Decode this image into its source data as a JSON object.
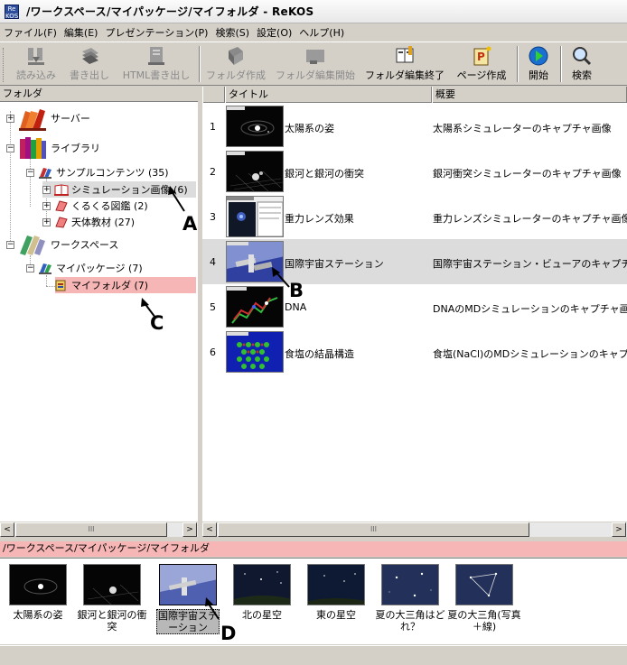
{
  "window": {
    "title": "/ワークスペース/マイパッケージ/マイフォルダ - ReKOS",
    "icon_text": "ReKOS"
  },
  "menu": [
    "ファイル(F)",
    "編集(E)",
    "プレゼンテーション(P)",
    "検索(S)",
    "設定(O)",
    "ヘルプ(H)"
  ],
  "toolbar": {
    "read": "読み込み",
    "export": "書き出し",
    "html_export": "HTML書き出し",
    "create_folder": "フォルダ作成",
    "start_folder_edit": "フォルダ編集開始",
    "end_folder_edit": "フォルダ編集終了",
    "create_page": "ページ作成",
    "start": "開始",
    "search": "検索"
  },
  "folder_panel": {
    "header": "フォルダ"
  },
  "tree": {
    "server": "サーバー",
    "library": "ライブラリ",
    "sample_contents": "サンプルコンテンツ (35)",
    "simulation_images": "シミュレーション画像 (6)",
    "kurukuru": "くるくる図鑑 (2)",
    "astronomy": "天体教材 (27)",
    "workspace": "ワークスペース",
    "my_package": "マイパッケージ (7)",
    "my_folder": "マイフォルダ (7)"
  },
  "list": {
    "columns": [
      "",
      "タイトル",
      "概要"
    ],
    "rows": [
      {
        "num": "1",
        "title": "太陽系の姿",
        "summary": "太陽系シミュレーターのキャプチャ画像"
      },
      {
        "num": "2",
        "title": "銀河と銀河の衝突",
        "summary": "銀河衝突シミュレーターのキャプチャ画像"
      },
      {
        "num": "3",
        "title": "重力レンズ効果",
        "summary": "重力レンズシミュレーターのキャプチャ画像"
      },
      {
        "num": "4",
        "title": "国際宇宙ステーション",
        "summary": "国際宇宙ステーション・ビューアのキャプチャ画像"
      },
      {
        "num": "5",
        "title": "DNA",
        "summary": "DNAのMDシミュレーションのキャプチャ画像"
      },
      {
        "num": "6",
        "title": "食塩の結晶構造",
        "summary": "食塩(NaCl)のMDシミュレーションのキャプチャ画像"
      }
    ]
  },
  "path_bar": "/ワークスペース/マイパッケージ/マイフォルダ",
  "strip": [
    {
      "caption": "太陽系の姿"
    },
    {
      "caption": "銀河と銀河の衝突"
    },
    {
      "caption": "国際宇宙ステーション"
    },
    {
      "caption": "北の星空"
    },
    {
      "caption": "東の星空"
    },
    {
      "caption": "夏の大三角はどれ？"
    },
    {
      "caption": "夏の大三角(写真＋線)"
    }
  ],
  "callouts": {
    "a": "A",
    "b": "B",
    "c": "C",
    "d": "D"
  },
  "scroll": {
    "thumb_glyph": "III",
    "left": "<",
    "right": ">"
  },
  "colors": {
    "highlight": "#f7b6b6",
    "selected_row": "#dcdcdc",
    "chrome": "#d4d0c8"
  }
}
